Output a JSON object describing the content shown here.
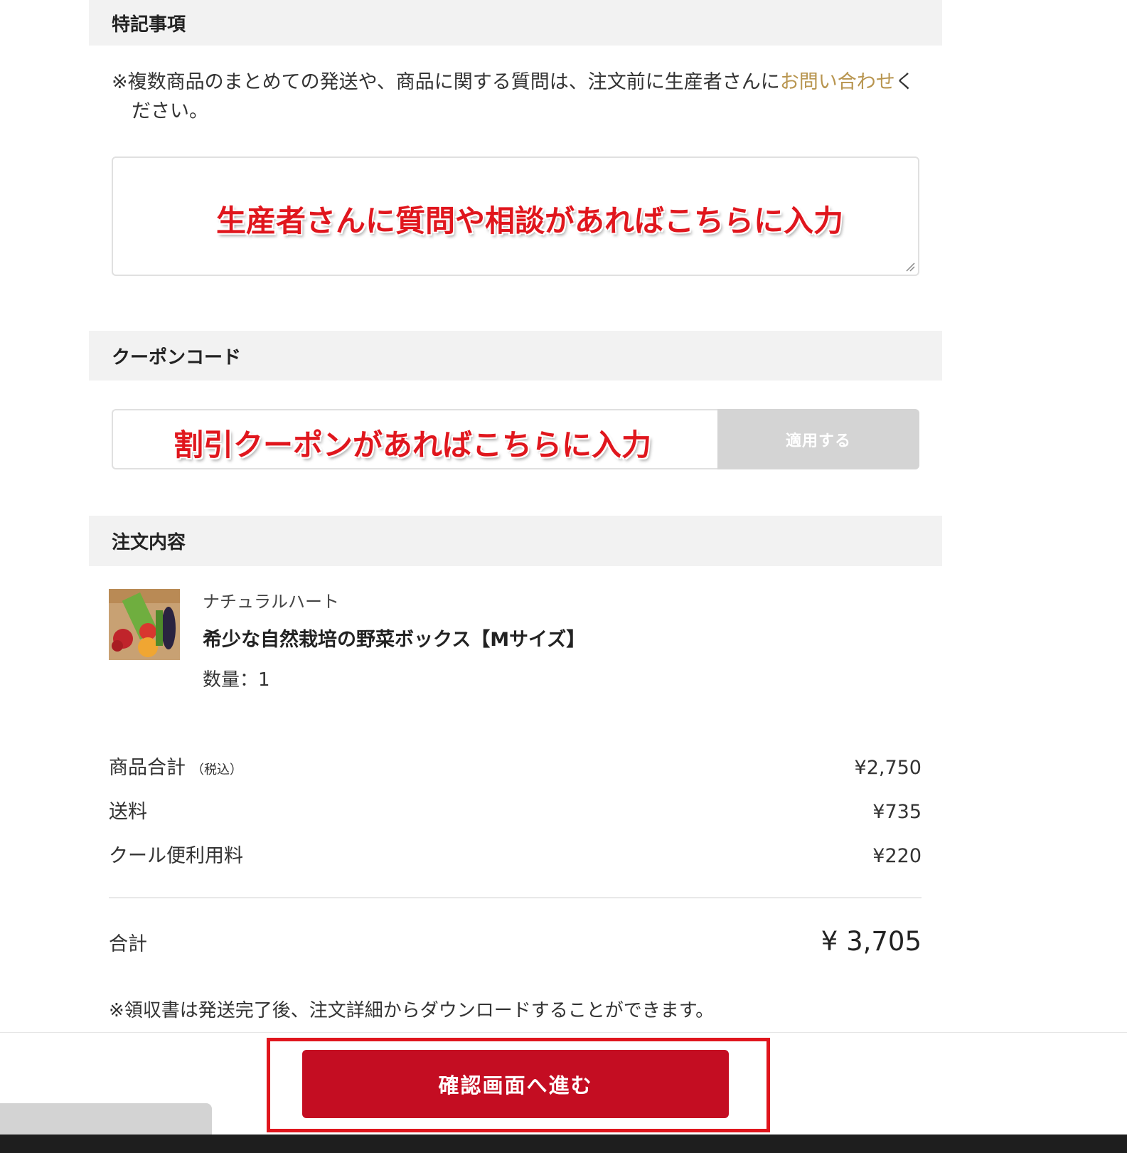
{
  "notes": {
    "title": "特記事項",
    "note_before_link": "※複数商品のまとめての発送や、商品に関する質問は、注文前に生産者さんに",
    "note_link": "お問い合わせ",
    "note_after_link": "ください。",
    "annotation": "生産者さんに質問や相談があればこちらに入力"
  },
  "coupon": {
    "title": "クーポンコード",
    "annotation": "割引クーポンがあればこちらに入力",
    "apply_label": "適用する"
  },
  "order": {
    "title": "注文内容",
    "producer": "ナチュラルハート",
    "product_name": "希少な自然栽培の野菜ボックス【Mサイズ】",
    "quantity": "数量：1"
  },
  "summary": {
    "subtotal_label": "商品合計",
    "subtotal_note": "（税込）",
    "subtotal_value": "¥2,750",
    "shipping_label": "送料",
    "shipping_value": "¥735",
    "cool_label": "クール便利用料",
    "cool_value": "¥220",
    "total_label": "合計",
    "total_value": "¥ 3,705",
    "receipt_note": "※領収書は発送完了後、注文詳細からダウンロードすることができます。"
  },
  "footer": {
    "proceed_label": "確認画面へ進む"
  },
  "colors": {
    "accent_red": "#c40d22",
    "annotation_red": "#e0161d",
    "link_gold": "#b8954f"
  }
}
